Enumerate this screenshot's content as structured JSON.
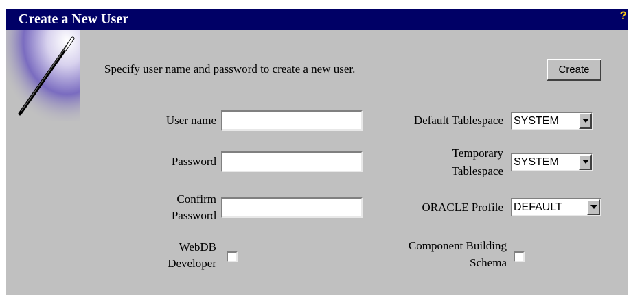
{
  "header": {
    "title": "Create a New User",
    "help_label": "?"
  },
  "intro": {
    "description": "Specify user name and password to create a new user.",
    "create_label": "Create"
  },
  "form": {
    "username": {
      "label": "User name",
      "value": ""
    },
    "password": {
      "label": "Password",
      "value": ""
    },
    "confirm": {
      "label_line1": "Confirm",
      "label_line2": "Password",
      "value": ""
    },
    "webdb": {
      "label_line1": "WebDB",
      "label_line2": "Developer",
      "checked": false
    },
    "default_ts": {
      "label": "Default Tablespace",
      "value": "SYSTEM"
    },
    "temp_ts": {
      "label_line1": "Temporary",
      "label_line2": "Tablespace",
      "value": "SYSTEM"
    },
    "profile": {
      "label": "ORACLE Profile",
      "value": "DEFAULT"
    },
    "component": {
      "label_line1": "Component Building",
      "label_line2": "Schema",
      "checked": false
    }
  },
  "colors": {
    "titlebar": "#000066",
    "panel": "#c0c0c0",
    "help": "#f5c518"
  },
  "icons": {
    "wizard": "magic-wand-icon",
    "help": "question-mark-icon"
  }
}
